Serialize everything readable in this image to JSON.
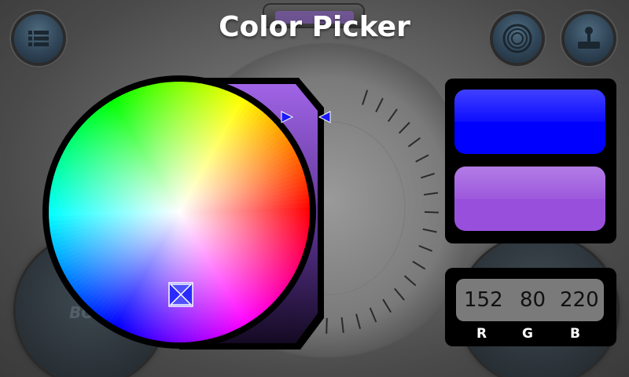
{
  "title": "Color Picker",
  "colors": {
    "selected": "#0000ff",
    "current": "#9850dc",
    "brightness_top": "#a064e6",
    "brightness_bottom": "#140a22"
  },
  "current_rgb": {
    "r": "152",
    "g": "80",
    "b": "220"
  },
  "rgb_labels": {
    "r": "R",
    "g": "G",
    "b": "B"
  },
  "toolbar": {
    "left_icon": "list-icon",
    "right_icons": [
      "radial-icon",
      "joystick-icon"
    ]
  },
  "background_label": "BO"
}
